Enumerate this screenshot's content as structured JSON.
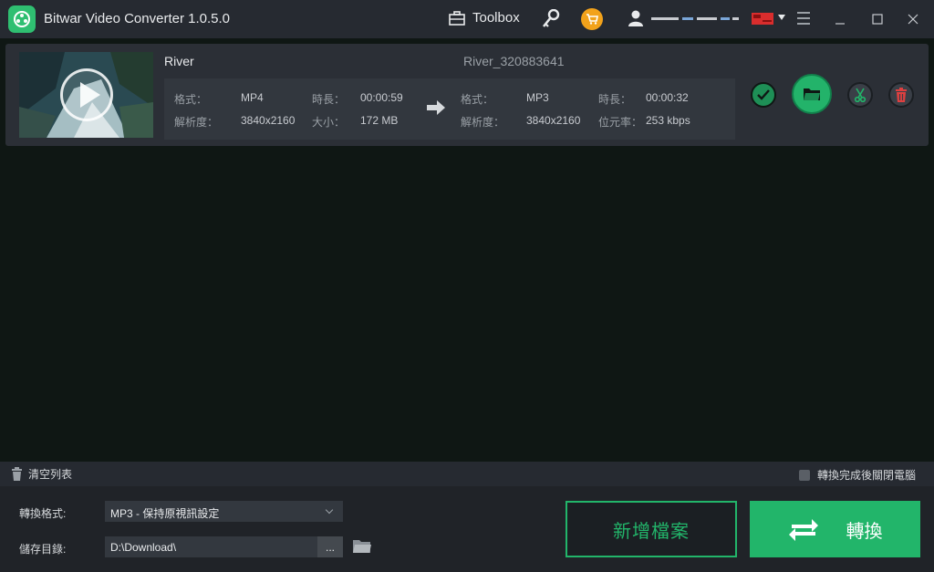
{
  "app": {
    "title": "Bitwar Video Converter  1.0.5.0",
    "toolbox_label": "Toolbox",
    "accent": "#22b56a",
    "icons": [
      "app-logo-icon",
      "toolbox-icon",
      "key-icon",
      "cart-icon",
      "user-icon",
      "flag-icon",
      "menu-icon",
      "minimize-icon",
      "maximize-icon",
      "close-icon"
    ]
  },
  "file": {
    "source_name": "River",
    "output_name": "River_320883641",
    "source": {
      "format_label": "格式：",
      "format": "MP4",
      "duration_label": "時長：",
      "duration": "00:00:59",
      "resolution_label": "解析度：",
      "resolution": "3840x2160",
      "size_label": "大小：",
      "size": "172 MB"
    },
    "output": {
      "format_label": "格式：",
      "format": "MP3",
      "duration_label": "時長：",
      "duration": "00:00:32",
      "resolution_label": "解析度：",
      "resolution": "3840x2160",
      "bitrate_label": "位元率：",
      "bitrate": "253 kbps"
    }
  },
  "bottom": {
    "clear_list": "清空列表",
    "shutdown_label": "轉換完成後關閉電腦",
    "format_label": "轉換格式:",
    "format_value": "MP3 - 保持原視訊設定",
    "save_label": "儲存目錄:",
    "save_path": "D:\\Download\\",
    "browse_label": "...",
    "add_file": "新增檔案",
    "convert": "轉換"
  }
}
